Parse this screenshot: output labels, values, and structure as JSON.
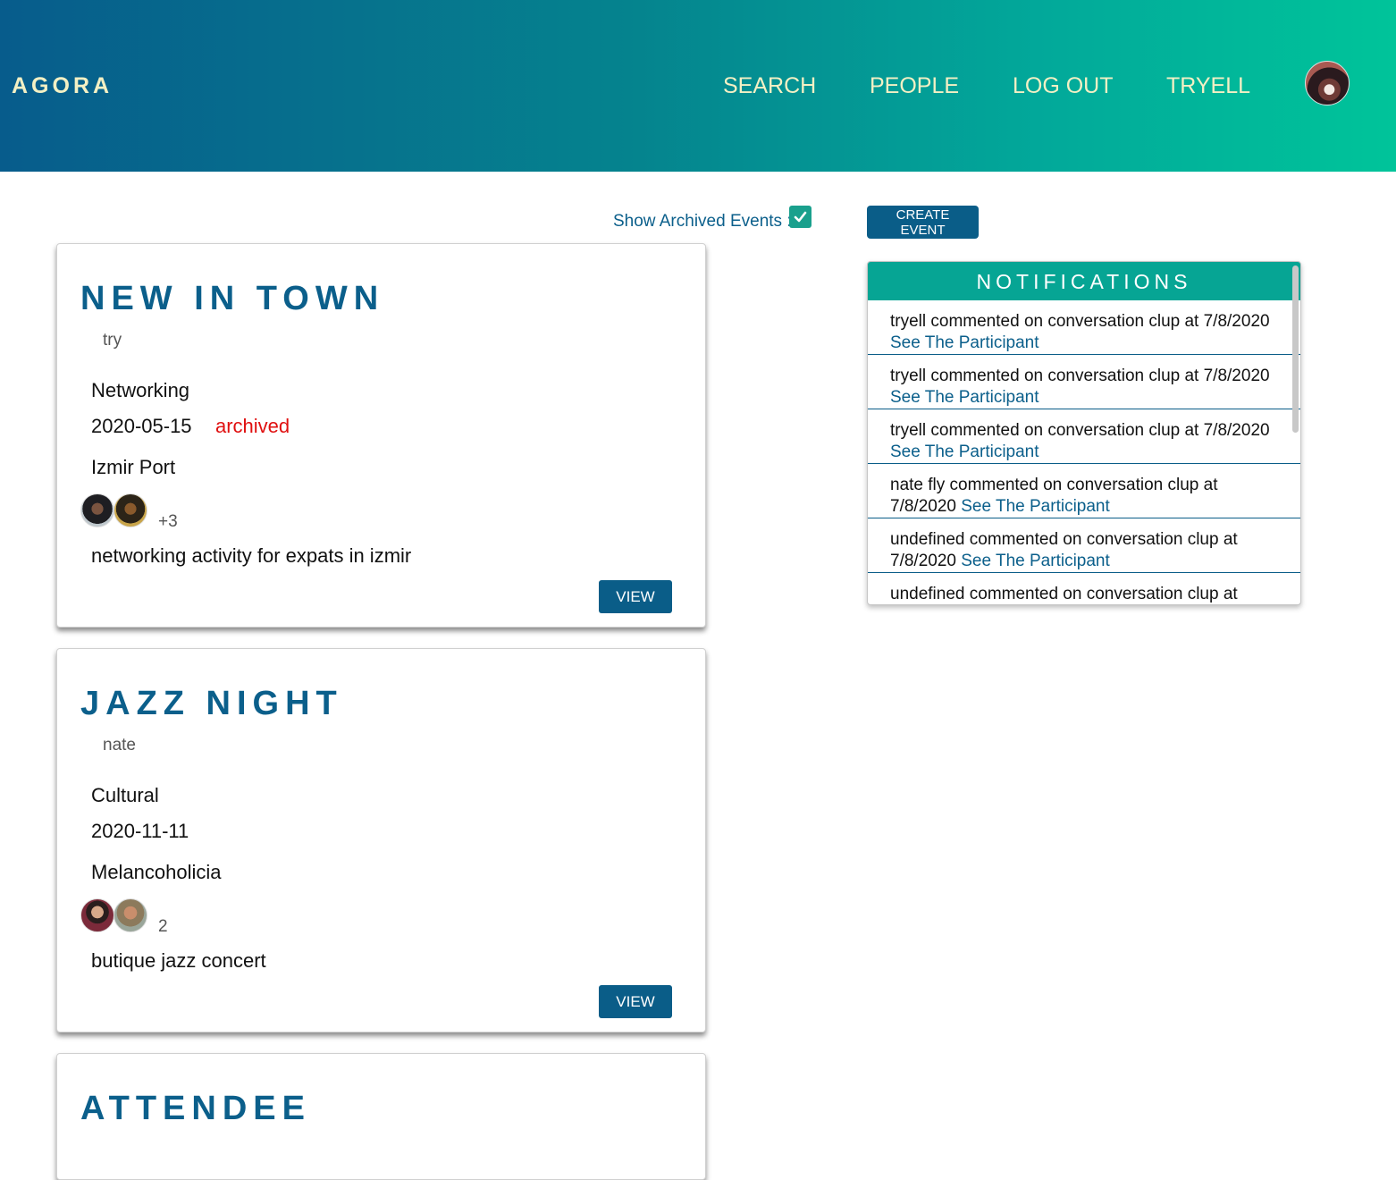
{
  "header": {
    "brand": "AGORA",
    "nav": [
      "SEARCH",
      "PEOPLE",
      "LOG OUT",
      "TRYELL"
    ],
    "avatar_icon": "user-avatar"
  },
  "controls": {
    "archived_label": "Show Archived Events :",
    "archived_checked": true,
    "create_label": "CREATE EVENT"
  },
  "notifications": {
    "title": "NOTIFICATIONS",
    "items": [
      {
        "text": "tryell commented on conversation clup at 7/8/2020",
        "link": "See The Participant"
      },
      {
        "text": "tryell commented on conversation clup at 7/8/2020",
        "link": "See The Participant"
      },
      {
        "text": "tryell commented on conversation clup at 7/8/2020",
        "link": "See The Participant"
      },
      {
        "text": "nate fly commented on conversation clup at 7/8/2020",
        "link": "See The Participant"
      },
      {
        "text": "undefined commented on conversation clup at 7/8/2020",
        "link": "See The Participant"
      },
      {
        "text": "undefined commented on conversation clup at",
        "link": ""
      }
    ]
  },
  "events": [
    {
      "title": "NEW IN TOWN",
      "owner": "try",
      "category": "Networking",
      "date": "2020-05-15",
      "status": "archived",
      "location": "Izmir Port",
      "count": "+3",
      "description": "networking activity for expats in izmir",
      "button": "VIEW"
    },
    {
      "title": "JAZZ NIGHT",
      "owner": "nate",
      "category": "Cultural",
      "date": "2020-11-11",
      "status": "",
      "location": "Melancoholicia",
      "count": "2",
      "description": "butique jazz concert",
      "button": "VIEW"
    },
    {
      "title": "ATTENDEE"
    }
  ]
}
